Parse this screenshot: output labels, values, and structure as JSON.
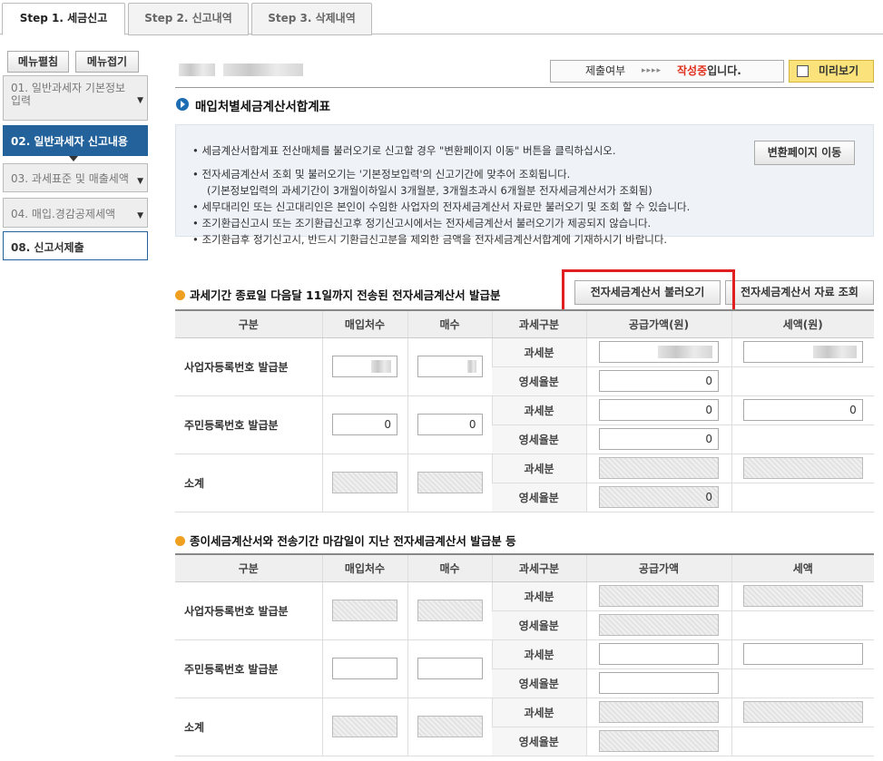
{
  "tabs": [
    "Step 1. 세금신고",
    "Step 2. 신고내역",
    "Step 3. 삭제내역"
  ],
  "menu_buttons": {
    "expand": "메뉴펼침",
    "collapse": "메뉴접기"
  },
  "sidebar": [
    {
      "label": "01. 일반과세자 기본정보 입력"
    },
    {
      "label": "02. 일반과세자 신고내용"
    },
    {
      "label": "03. 과세표준 및 매출세액"
    },
    {
      "label": "04. 매입.경감공제세액"
    },
    {
      "label": "08. 신고서제출"
    }
  ],
  "status": {
    "label": "제출여부",
    "arrows": "▸▸▸▸",
    "state": "작성중",
    "suffix": "입니다.",
    "preview": "미리보기"
  },
  "page_title": "매입처별세금계산서합계표",
  "info": {
    "lines": [
      "• 세금계산서합계표 전산매체를 불러오기로 신고할 경우 \"변환페이지 이동\" 버튼을 클릭하십시오.",
      "• 전자세금계산서 조회 및 불러오기는 '기본정보입력'의 신고기간에 맞추어 조회됩니다.",
      "(기본정보입력의 과세기간이 3개월이하일시 3개월분, 3개월초과시 6개월분 전자세금계산서가 조회됨)",
      "• 세무대리인 또는 신고대리인은 본인이 수임한 사업자의 전자세금계산서 자료만 불러오기 및 조회 할 수 있습니다.",
      "• 조기환급신고시 또는 조기환급신고후 정기신고시에서는 전자세금계산서 불러오기가 제공되지 않습니다.",
      "• 조기환급후 정기신고시, 반드시 기환급신고분을 제외한 금액을 전자세금계산서합계에 기재하시기 바랍니다."
    ],
    "convert_button": "변환페이지 이동"
  },
  "section1": {
    "title": "과세기간 종료일 다음달 11일까지 전송된 전자세금계산서 발급분",
    "load_button": "전자세금계산서 불러오기",
    "view_button": "전자세금계산서 자료 조회",
    "headers": [
      "구분",
      "매입처수",
      "매수",
      "과세구분",
      "공급가액(원)",
      "세액(원)"
    ],
    "rows": [
      {
        "label": "사업자등록번호 발급분",
        "taxable": "과세분",
        "zero": "영세율분",
        "supply_zero": "0"
      },
      {
        "label": "주민등록번호 발급분",
        "buyers": "0",
        "count": "0",
        "taxable": "과세분",
        "zero": "영세율분",
        "supply_tax": "0",
        "supply_zero": "0",
        "tax": "0"
      },
      {
        "label": "소계",
        "taxable": "과세분",
        "zero": "영세율분",
        "supply_zero": "0"
      }
    ]
  },
  "section2": {
    "title": "종이세금계산서와 전송기간 마감일이 지난 전자세금계산서 발급분 등",
    "headers": [
      "구분",
      "매입처수",
      "매수",
      "과세구분",
      "공급가액",
      "세액"
    ],
    "rows": [
      {
        "label": "사업자등록번호 발급분",
        "taxable": "과세분",
        "zero": "영세율분"
      },
      {
        "label": "주민등록번호 발급분",
        "taxable": "과세분",
        "zero": "영세율분"
      },
      {
        "label": "소계",
        "taxable": "과세분",
        "zero": "영세율분"
      }
    ]
  }
}
